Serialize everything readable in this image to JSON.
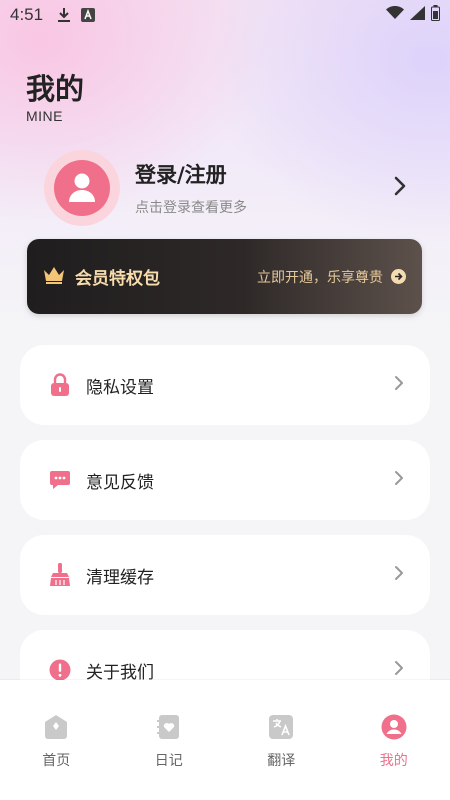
{
  "status_bar": {
    "time": "4:51",
    "icons": [
      "download-icon",
      "a-icon",
      "wifi-icon",
      "signal-icon",
      "battery-icon"
    ]
  },
  "header": {
    "title": "我的",
    "subtitle": "MINE"
  },
  "profile": {
    "login_label": "登录/注册",
    "hint": "点击登录查看更多"
  },
  "vip": {
    "title": "会员特权包",
    "cta": "立即开通，乐享尊贵",
    "icon": "crown-icon"
  },
  "menu": [
    {
      "label": "隐私设置",
      "icon": "lock-icon"
    },
    {
      "label": "意见反馈",
      "icon": "chat-icon"
    },
    {
      "label": "清理缓存",
      "icon": "broom-icon"
    },
    {
      "label": "关于我们",
      "icon": "info-icon"
    }
  ],
  "tabs": [
    {
      "label": "首页",
      "icon": "home-icon"
    },
    {
      "label": "日记",
      "icon": "diary-icon"
    },
    {
      "label": "翻译",
      "icon": "translate-icon"
    },
    {
      "label": "我的",
      "icon": "profile-icon",
      "active": true
    }
  ],
  "colors": {
    "accent": "#f06f8b",
    "vip_gold": "#f7dcae"
  }
}
